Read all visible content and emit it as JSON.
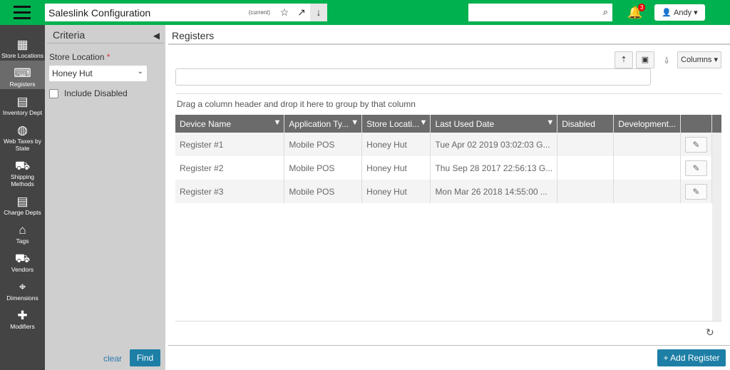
{
  "header": {
    "title": "Saleslink Configuration",
    "current": "(current)",
    "notifications": "3",
    "user": "Andy"
  },
  "nav": [
    {
      "label": "Store Locations",
      "icon": "building-icon"
    },
    {
      "label": "Registers",
      "icon": "register-icon"
    },
    {
      "label": "Inventory Dept",
      "icon": "list-icon"
    },
    {
      "label": "Web Taxes by State",
      "icon": "globe-icon"
    },
    {
      "label": "Shipping Methods",
      "icon": "truck-icon"
    },
    {
      "label": "Charge Depts",
      "icon": "list-icon"
    },
    {
      "label": "Tags",
      "icon": "tags-icon"
    },
    {
      "label": "Vendors",
      "icon": "truck-icon"
    },
    {
      "label": "Dimensions",
      "icon": "crosshair-icon"
    },
    {
      "label": "Modifiers",
      "icon": "plus-icon"
    }
  ],
  "criteria": {
    "title": "Criteria",
    "store_label": "Store Location",
    "required": "*",
    "store_value": "Honey Hut",
    "include_disabled": "Include Disabled",
    "clear": "clear",
    "find": "Find"
  },
  "main": {
    "title": "Registers",
    "columns_btn": "Columns",
    "group_hint": "Drag a column header and drop it here to group by that column",
    "add": "+ Add Register"
  },
  "table": {
    "headers": [
      "Device Name",
      "Application Ty...",
      "Store Locati...",
      "Last Used Date",
      "Disabled",
      "Development..."
    ],
    "rows": [
      [
        "Register #1",
        "Mobile POS",
        "Honey Hut",
        "Tue Apr 02 2019 03:02:03 G...",
        "",
        ""
      ],
      [
        "Register #2",
        "Mobile POS",
        "Honey Hut",
        "Thu Sep 28 2017 22:56:13 G...",
        "",
        ""
      ],
      [
        "Register #3",
        "Mobile POS",
        "Honey Hut",
        "Mon Mar 26 2018 14:55:00 ...",
        "",
        ""
      ]
    ]
  },
  "colors": {
    "brand": "#00b14f",
    "primary": "#1d7fa6"
  }
}
